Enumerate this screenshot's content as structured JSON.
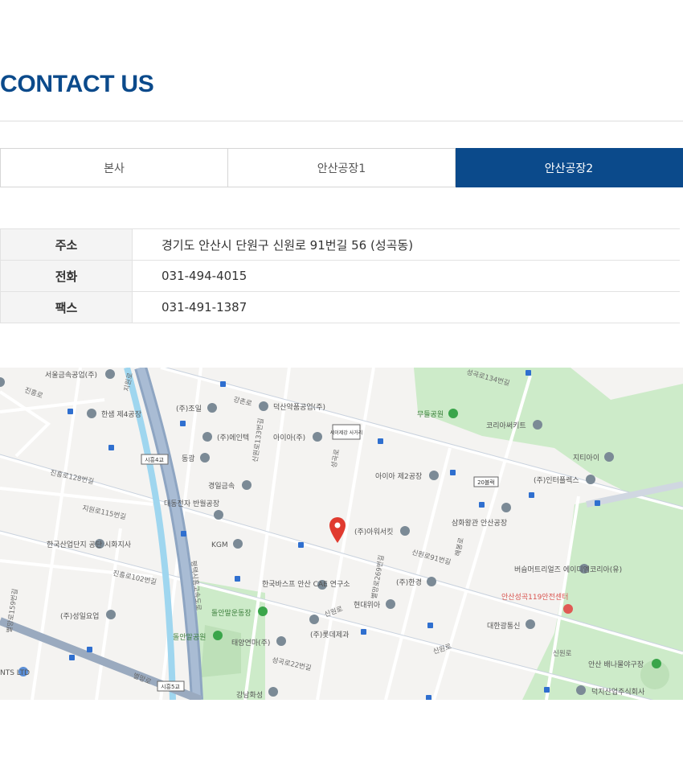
{
  "page_title": "CONTACT US",
  "tabs": [
    {
      "label": "본사",
      "active": false
    },
    {
      "label": "안산공장1",
      "active": false
    },
    {
      "label": "안산공장2",
      "active": true
    }
  ],
  "info": {
    "address_label": "주소",
    "address_value": "경기도 안산시 단원구 신원로 91번길 56 (성곡동)",
    "phone_label": "전화",
    "phone_value": "031-494-4015",
    "fax_label": "팩스",
    "fax_value": "031-491-1387"
  },
  "colors": {
    "brand": "#0b4a8b",
    "tab_active_bg": "#0b4a8b",
    "marker_red": "#e03a2f"
  },
  "map": {
    "places": {
      "p1": "서울금속공업(주)",
      "p2": "한샘 제4공장",
      "p3": "(주)조일",
      "p4": "덕산약품공업(주)",
      "p5": "(주)에인텍",
      "p6": "아이아(주)",
      "p7": "동광",
      "p8": "경일금속",
      "p9": "대동전자 반월공장",
      "p10": "KGM",
      "p11": "한국산업단지 공단 시화지사",
      "p12": "한국바스프 안산 CAE 연구소",
      "p13": "(주)성일요업",
      "p14": "돌안말운동장",
      "p15": "돌안말공원",
      "p16": "태양연마(주)",
      "p17": "(주)롯데제과",
      "p18": "현대위아",
      "p19": "(주)한경",
      "p20": "(주)아워서킷",
      "p21": "아이아 제2공장",
      "p22": "무들공원",
      "p23": "코리아써키트",
      "p24": "지티아이",
      "p25": "(주)인터플렉스",
      "p26": "삼화왕관 안산공장",
      "p27": "버슘머트리얼즈 에이디엠코리아(유)",
      "p28": "안산성곡119안전센터",
      "p29": "대한광통신",
      "p30": "안산 배나물야구장",
      "p31": "덕지산업주식회사",
      "p32": "강남화성",
      "p33": "NTS LTD"
    },
    "roads": {
      "r1": "강촌로",
      "r2": "신원로133번길",
      "r3": "성곡로",
      "r4": "신원로91번길",
      "r5": "신원로",
      "r6": "성곡로22번길",
      "r7": "별망로269번길",
      "r8": "해봉로",
      "r9": "성곡로134번길",
      "r10": "지원로",
      "r11": "진흥로128번길",
      "r12": "지원로115번길",
      "r13": "진흥로102번길",
      "r14": "별망로159번길",
      "r15": "별망로",
      "r16": "평택시흥고속도로",
      "r17": "진흥로"
    },
    "badges": {
      "b1": "시흥4교",
      "b2": "시흥5교",
      "b3": "20블럭",
      "b4": "세이제강 사거리"
    }
  }
}
